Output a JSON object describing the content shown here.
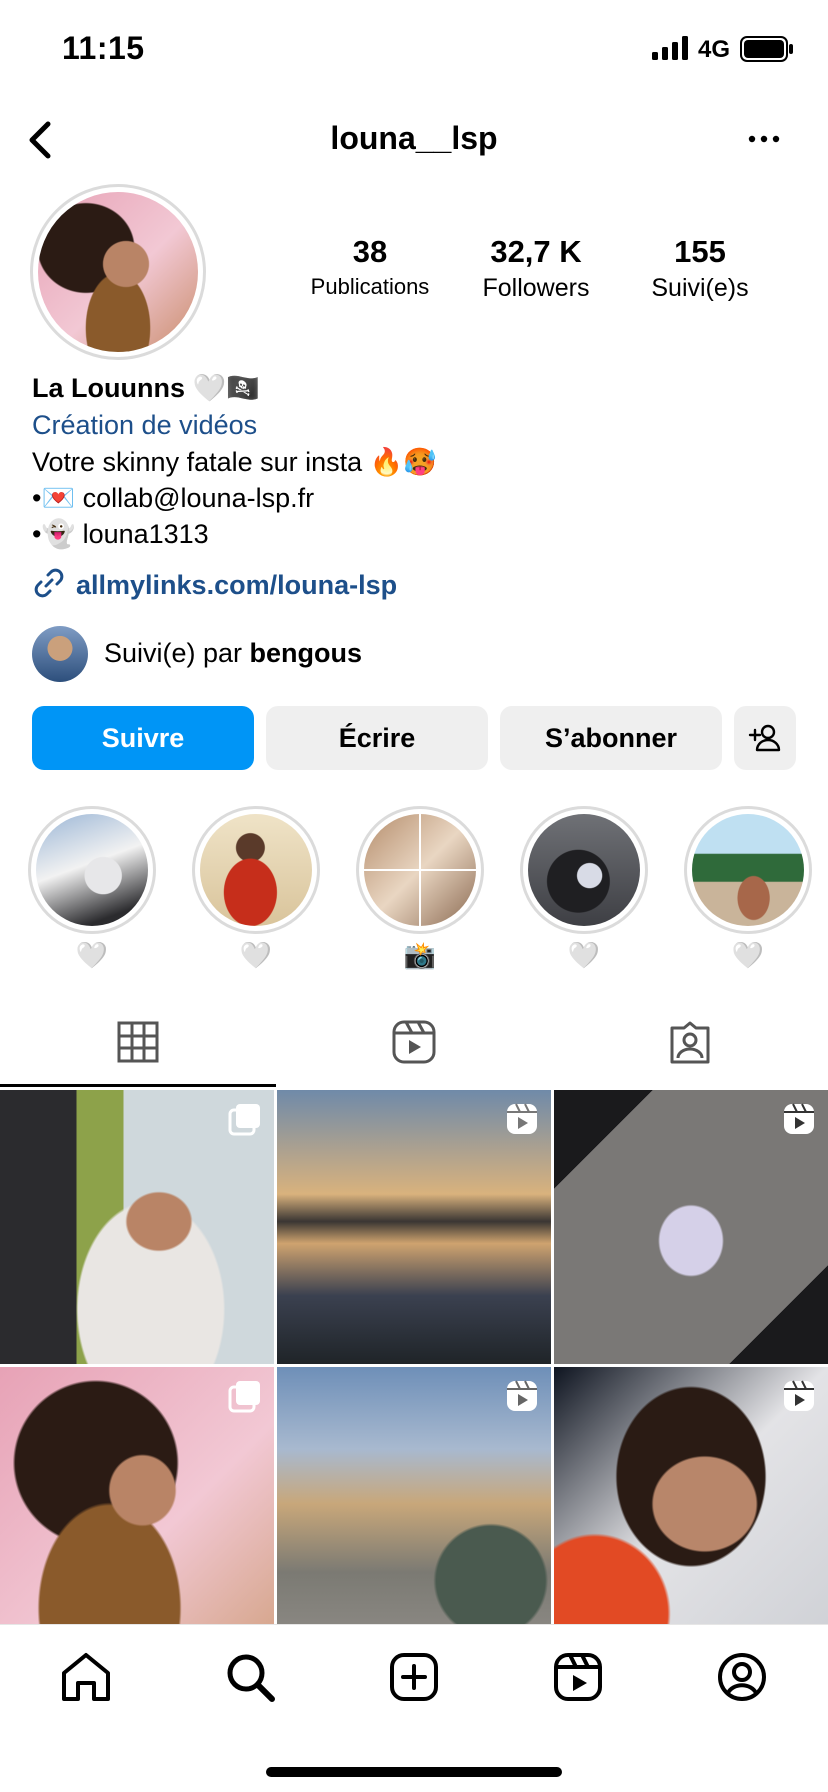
{
  "status_bar": {
    "time": "11:15",
    "network": "4G"
  },
  "header": {
    "username": "louna__lsp"
  },
  "profile": {
    "stats": [
      {
        "value": "38",
        "label": "Publications"
      },
      {
        "value": "32,7 K",
        "label": "Followers"
      },
      {
        "value": "155",
        "label": "Suivi(e)s"
      }
    ],
    "name": "La Louunns 🤍🏴‍☠️",
    "category": "Création de vidéos",
    "bio_lines": [
      "Votre skinny fatale sur insta 🔥🥵",
      "•💌 collab@louna-lsp.fr",
      "•👻 louna1313"
    ],
    "link": "allmylinks.com/louna-lsp",
    "followed_by_prefix": "Suivi(e) par ",
    "followed_by_name": "bengous"
  },
  "actions": {
    "follow": "Suivre",
    "message": "Écrire",
    "subscribe": "S’abonner"
  },
  "highlights": [
    {
      "label": "🤍"
    },
    {
      "label": "🤍"
    },
    {
      "label": "📸"
    },
    {
      "label": "🤍"
    },
    {
      "label": "🤍"
    }
  ],
  "icons": {
    "back": "chevron-left-icon",
    "more": "ellipsis-icon",
    "link": "link-icon",
    "add_friend": "add-person-icon",
    "tabs": [
      "grid-icon",
      "reels-icon",
      "tagged-icon"
    ],
    "bottom_nav": [
      "home-icon",
      "search-icon",
      "create-icon",
      "reels-icon",
      "profile-icon"
    ]
  },
  "colors": {
    "primary": "#0095f6",
    "link": "#1d4f8a",
    "button_gray": "#efefef"
  }
}
